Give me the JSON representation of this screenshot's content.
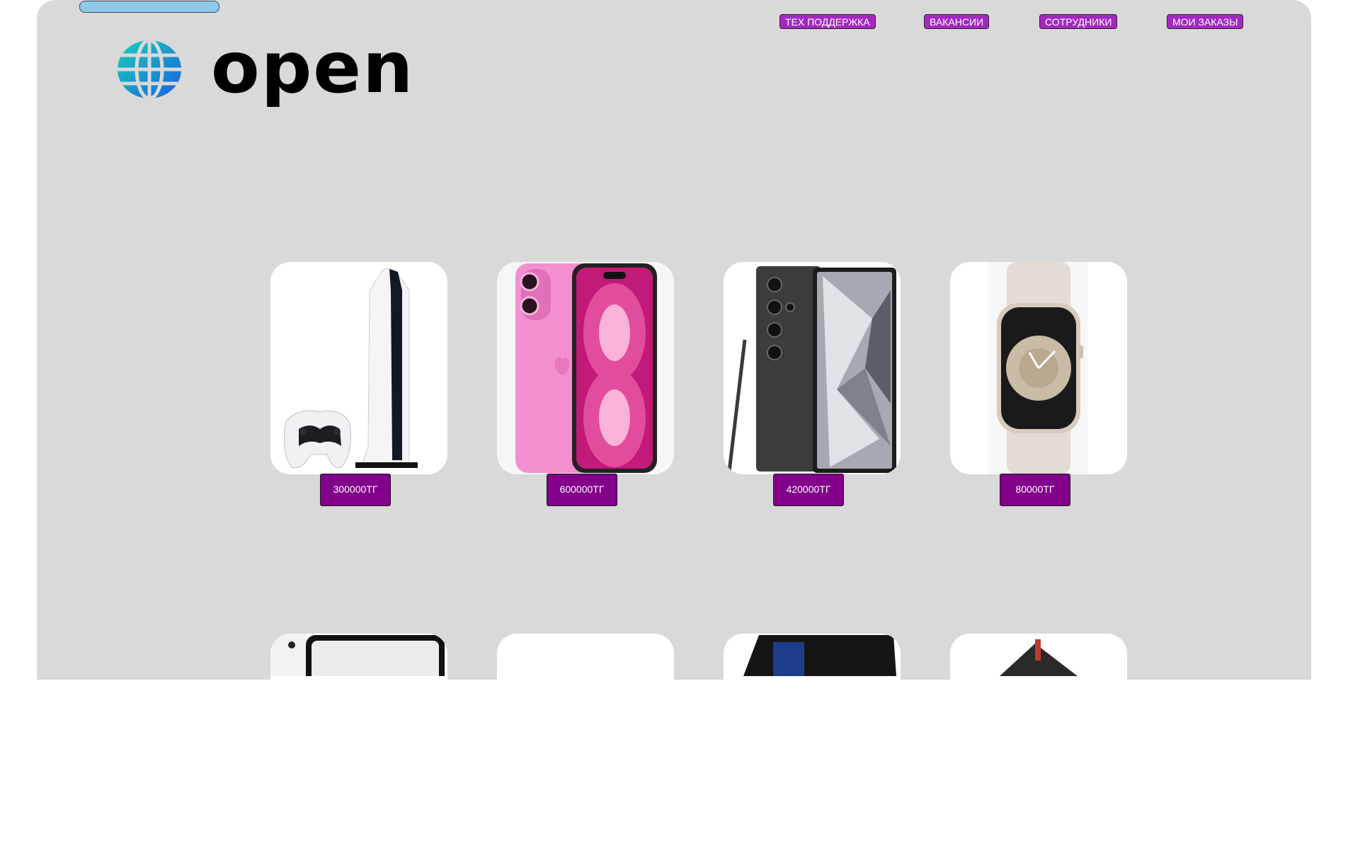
{
  "brand": {
    "name": "open"
  },
  "nav": {
    "items": [
      {
        "label": "ТЕХ ПОДДЕРЖКА"
      },
      {
        "label": "ВАКАНСИИ"
      },
      {
        "label": "СОТРУДНИКИ"
      },
      {
        "label": "МОИ ЗАКАЗЫ"
      }
    ]
  },
  "products": [
    {
      "name": "game-console",
      "price": "300000ТГ"
    },
    {
      "name": "pink-phone",
      "price": "600000ТГ"
    },
    {
      "name": "dark-phone",
      "price": "420000ТГ"
    },
    {
      "name": "smartwatch",
      "price": "80000ТГ"
    }
  ],
  "colors": {
    "panel": "#d9d9d9",
    "nav_button": "#a229bf",
    "price_button": "#82008a",
    "search_bar": "#8ec9ea"
  }
}
